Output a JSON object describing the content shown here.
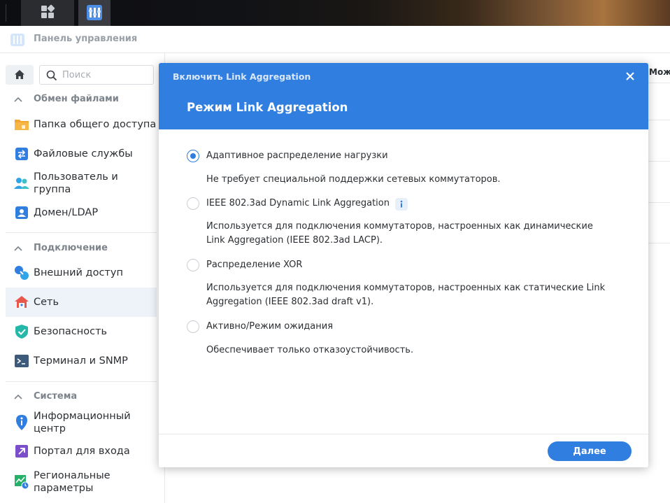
{
  "window": {
    "title": "Панель управления"
  },
  "sidebar": {
    "search": {
      "placeholder": "Поиск"
    },
    "sections": [
      {
        "title": "Обмен файлами",
        "items": [
          {
            "label": "Папка общего доступа",
            "icon": "folder-icon"
          },
          {
            "label": "Файловые службы",
            "icon": "file-services-icon"
          },
          {
            "label": "Пользователь и группа",
            "icon": "users-icon"
          },
          {
            "label": "Домен/LDAP",
            "icon": "domain-icon"
          }
        ]
      },
      {
        "title": "Подключение",
        "items": [
          {
            "label": "Внешний доступ",
            "icon": "external-access-icon"
          },
          {
            "label": "Сеть",
            "icon": "network-icon",
            "active": true
          },
          {
            "label": "Безопасность",
            "icon": "shield-icon"
          },
          {
            "label": "Терминал и SNMP",
            "icon": "terminal-icon"
          }
        ]
      },
      {
        "title": "Система",
        "items": [
          {
            "label": "Информационный центр",
            "icon": "info-center-icon"
          },
          {
            "label": "Портал для входа",
            "icon": "login-portal-icon"
          },
          {
            "label": "Региональные параметры",
            "icon": "regional-icon"
          }
        ]
      }
    ]
  },
  "background": {
    "partial_text": "Можно"
  },
  "dialog": {
    "small_title": "Включить Link Aggregation",
    "title": "Режим Link Aggregation",
    "options": [
      {
        "label": "Адаптивное распределение нагрузки",
        "description": "Не требует специальной поддержки сетевых коммутаторов.",
        "selected": true
      },
      {
        "label": "IEEE 802.3ad Dynamic Link Aggregation",
        "description": "Используется для подключения коммутаторов, настроенных как динамические Link Aggregation (IEEE 802.3ad LACP).",
        "selected": false,
        "has_info": true
      },
      {
        "label": "Распределение XOR",
        "description": "Используется для подключения коммутаторов, настроенных как статические Link Aggregation (IEEE 802.3ad draft v1).",
        "selected": false
      },
      {
        "label": "Активно/Режим ожидания",
        "description": "Обеспечивает только отказоустойчивость.",
        "selected": false
      }
    ],
    "next_label": "Далее"
  },
  "colors": {
    "accent": "#2f7ee0",
    "header": "#2f7ee0",
    "active_nav": "#eef3f9"
  }
}
